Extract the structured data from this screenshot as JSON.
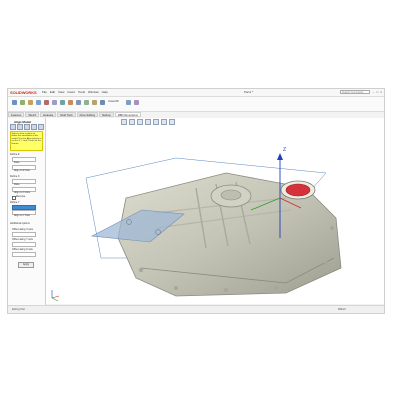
{
  "app": {
    "logo": "SOLIDWORKS",
    "menu": [
      "File",
      "Edit",
      "View",
      "Insert",
      "Tools",
      "Window",
      "Help"
    ],
    "document_title": "Part1 *",
    "search_placeholder": "Search Commands",
    "window_buttons": [
      "–",
      "□",
      "×"
    ]
  },
  "ribbon": {
    "labels": [
      "Instant3D",
      "Sketch",
      "Extruded Cut",
      "Shell",
      "Mirror"
    ]
  },
  "tabs": [
    {
      "label": "Features",
      "active": false
    },
    {
      "label": "Sketch",
      "active": false
    },
    {
      "label": "Evaluate",
      "active": false
    },
    {
      "label": "Mold Tools",
      "active": false
    },
    {
      "label": "Direct Editing",
      "active": false
    },
    {
      "label": "Markup",
      "active": false
    },
    {
      "label": "MBD Dimensions",
      "active": true
    }
  ],
  "panel": {
    "title": "Align Model",
    "help_text": "Select a face or plane to define the orientation of the model. Use the Align pattern to set the X, Y and Z axes for the feature.",
    "sections": [
      {
        "label": "Define Z"
      },
      {
        "label": "Face"
      },
      {
        "label": "Align to Z Axis"
      },
      {
        "label": "Define X"
      },
      {
        "label": "Face"
      },
      {
        "label": "Align to X Axis"
      },
      {
        "label": "Reverse"
      },
      {
        "label": "Define Y"
      },
      {
        "label": "Align to Y Axis"
      },
      {
        "label": "Additional options"
      },
      {
        "label": "Offset along X axis"
      },
      {
        "label": "Offset along Y axis"
      },
      {
        "label": "Offset along Z axis"
      }
    ],
    "ok_label": "Apply"
  },
  "viewport": {
    "axis_label_z": "Z",
    "part_color": "#c9c9bb",
    "bore_color": "#d6323c",
    "plane_color": "#9fb8d6"
  },
  "status": {
    "left": "Editing Part",
    "right": "MMGS"
  }
}
